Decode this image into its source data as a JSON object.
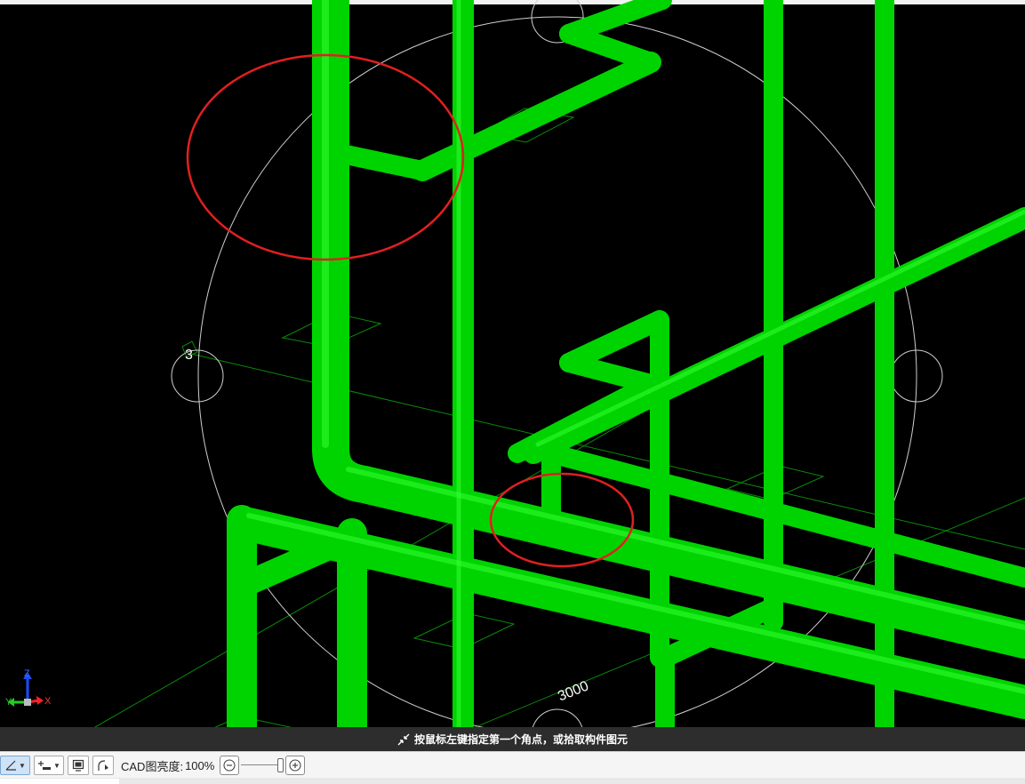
{
  "viewport": {
    "background": "#000000",
    "pipe_color": "#00d400",
    "annotation_color": "#e02020",
    "labels": {
      "grid_number": "3",
      "dimension": "3000"
    }
  },
  "axis_gizmo": {
    "z": "Z",
    "y": "Y",
    "x": "X"
  },
  "status_prompt": {
    "icon": "pick-cursor-icon",
    "text": "按鼠标左键指定第一个角点，或拾取构件图元"
  },
  "toolbar": {
    "angle_tool_icon": "angle-icon",
    "snap_tool_icon": "snap-icon",
    "display_tool_icon": "display-icon",
    "curve_tool_icon": "curve-icon",
    "cad_brightness_label": "CAD图亮度:",
    "cad_brightness_value": "100%",
    "brightness_level": 1.0
  }
}
